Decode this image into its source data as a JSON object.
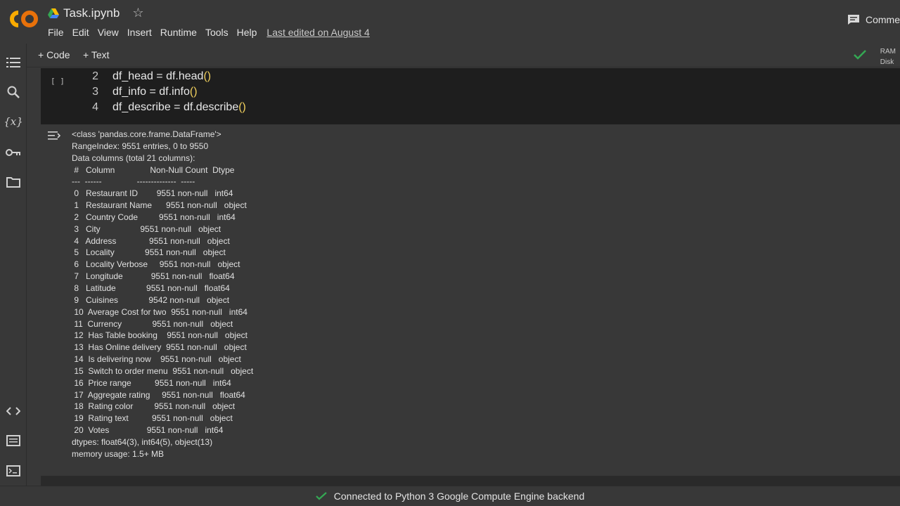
{
  "header": {
    "title": "Task.ipynb",
    "menu": [
      "File",
      "Edit",
      "View",
      "Insert",
      "Runtime",
      "Tools",
      "Help"
    ],
    "last_edited": "Last edited on August 4",
    "comment_label": "Comme"
  },
  "toolbar": {
    "add_code": "+ Code",
    "add_text": "+ Text",
    "ram_label": "RAM",
    "disk_label": "Disk"
  },
  "cell": {
    "run_bracket": "[ ]",
    "lines": [
      {
        "num": "2",
        "code": "df_head = df.head",
        "paren": "()"
      },
      {
        "num": "3",
        "code": "df_info = df.info",
        "paren": "()"
      },
      {
        "num": "4",
        "code": "df_describe = df.describe",
        "paren": "()"
      }
    ]
  },
  "output": {
    "lines": [
      "<class 'pandas.core.frame.DataFrame'>",
      "RangeIndex: 9551 entries, 0 to 9550",
      "Data columns (total 21 columns):",
      " #   Column               Non-Null Count  Dtype",
      "---  ------               --------------  -----",
      " 0   Restaurant ID        9551 non-null   int64",
      " 1   Restaurant Name      9551 non-null   object",
      " 2   Country Code         9551 non-null   int64",
      " 3   City                 9551 non-null   object",
      " 4   Address              9551 non-null   object",
      " 5   Locality             9551 non-null   object",
      " 6   Locality Verbose     9551 non-null   object",
      " 7   Longitude            9551 non-null   float64",
      " 8   Latitude             9551 non-null   float64",
      " 9   Cuisines             9542 non-null   object",
      " 10  Average Cost for two  9551 non-null   int64",
      " 11  Currency             9551 non-null   object",
      " 12  Has Table booking    9551 non-null   object",
      " 13  Has Online delivery  9551 non-null   object",
      " 14  Is delivering now    9551 non-null   object",
      " 15  Switch to order menu  9551 non-null   object",
      " 16  Price range          9551 non-null   int64",
      " 17  Aggregate rating     9551 non-null   float64",
      " 18  Rating color         9551 non-null   object",
      " 19  Rating text          9551 non-null   object",
      " 20  Votes                9551 non-null   int64",
      "dtypes: float64(3), int64(5), object(13)",
      "memory usage: 1.5+ MB"
    ]
  },
  "status": {
    "text": "Connected to Python 3 Google Compute Engine backend"
  },
  "colors": {
    "accent_check": "#34a853",
    "logo_orange": "#f9ab00",
    "paren_yellow": "#f2d15e"
  }
}
